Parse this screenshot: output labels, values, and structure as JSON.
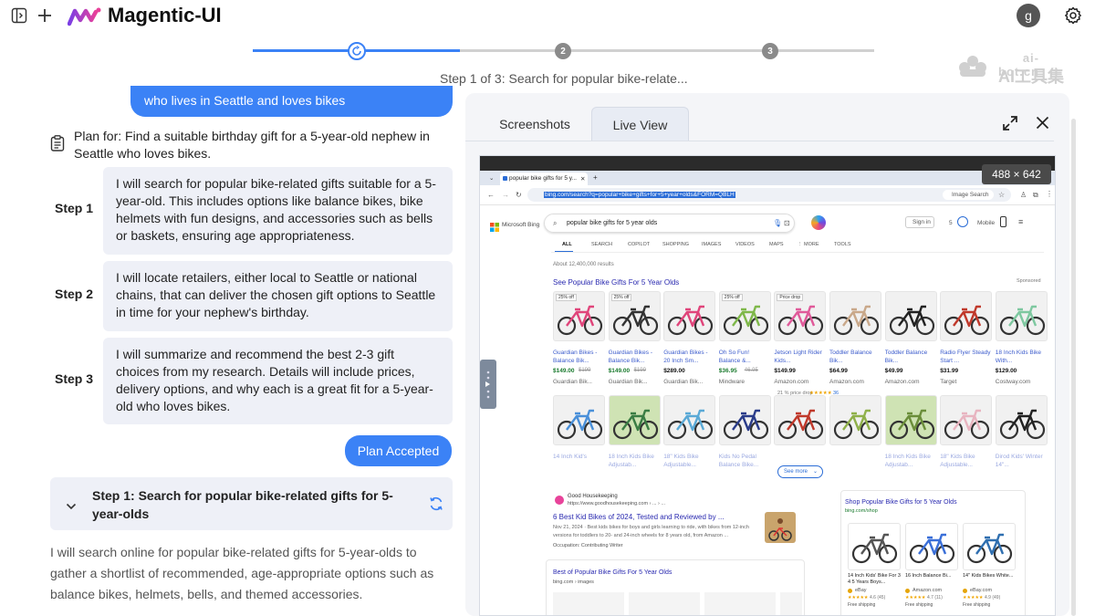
{
  "app": {
    "title": "Magentic-UI",
    "avatar_initial": "g"
  },
  "progress": {
    "steps": [
      "1",
      "2",
      "3"
    ],
    "current_step": 1,
    "caption": "Step 1 of 3: Search for popular bike-relate..."
  },
  "watermark": {
    "line1": "ai-bot.cn",
    "line2": "AI工具集"
  },
  "chat": {
    "user_message": "who lives in Seattle and loves bikes",
    "plan_title": "Plan for: Find a suitable birthday gift for a 5-year-old nephew in Seattle who loves bikes.",
    "steps": [
      {
        "label": "Step 1",
        "text": "I will search for popular bike-related gifts suitable for a 5-year-old. This includes options like balance bikes, bike helmets with fun designs, and accessories such as bells or baskets, ensuring age appropriateness."
      },
      {
        "label": "Step 2",
        "text": "I will locate retailers, either local to Seattle or national chains, that can deliver the chosen gift options to Seattle in time for your nephew's birthday."
      },
      {
        "label": "Step 3",
        "text": "I will summarize and recommend the best 2-3 gift choices from my research. Details will include prices, delivery options, and why each is a great fit for a 5-year-old who loves bikes."
      }
    ],
    "plan_accepted_label": "Plan Accepted",
    "current_step_title": "Step 1: Search for popular bike-related gifts for 5-year-olds",
    "current_step_summary": "I will search online for popular bike-related gifts for 5-year-olds to gather a shortlist of recommended, age-appropriate options such as balance bikes, helmets, bells, and themed accessories."
  },
  "panel": {
    "tabs": [
      "Screenshots",
      "Live View"
    ],
    "active_tab": "Live View",
    "size_badge": "488 × 642"
  },
  "browser": {
    "tab_title": "popular bike gifts for 5 y...",
    "url": "bing.com/search?q=popular+bike+gifts+for+5+year+olds&FORM=QBLH",
    "image_search": "Image Search",
    "logo": "Microsoft Bing",
    "query": "popular bike gifts for 5 year olds",
    "sign_in": "Sign in",
    "mobile": "Mobile",
    "nav": [
      "ALL",
      "SEARCH",
      "COPILOT",
      "SHOPPING",
      "IMAGES",
      "VIDEOS",
      "MAPS",
      "⋮ MORE",
      "TOOLS"
    ],
    "result_count": "About 12,400,000 results",
    "shopping_title": "See Popular Bike Gifts For 5 Year Olds",
    "sponsored": "Sponsored",
    "products_row1": [
      {
        "badge": "25% off",
        "name": "Guardian Bikes - Balance Bik...",
        "price": "$149.00",
        "old": "$199",
        "store": "Guardian Bik...",
        "color": "#e0457b"
      },
      {
        "badge": "25% off",
        "name": "Guardian Bikes - Balance Bik...",
        "price": "$149.00",
        "old": "$199",
        "store": "Guardian Bik...",
        "color": "#333"
      },
      {
        "badge": "",
        "name": "Guardian Bikes - 20 Inch Sm...",
        "price": "$289.00",
        "old": "",
        "store": "Guardian Bik...",
        "color": "#e0457b"
      },
      {
        "badge": "25% off",
        "name": "Oh So Fun! Balance &...",
        "price": "$36.95",
        "old": "46.95",
        "store": "Mindware",
        "color": "#7fb84a"
      },
      {
        "badge": "Price drop",
        "name": "Jetson Light Rider Kids...",
        "price": "$149.99",
        "old": "",
        "store": "Amazon.com",
        "color": "#e05a9a"
      },
      {
        "badge": "",
        "name": "Toddler Balance Bik...",
        "price": "$64.99",
        "old": "",
        "store": "Amazon.com",
        "color": "#c9a88a"
      },
      {
        "badge": "",
        "name": "Toddler Balance Bik...",
        "price": "$49.99",
        "old": "",
        "store": "Amazon.com",
        "color": "#222"
      },
      {
        "badge": "",
        "name": "Radio Flyer Steady Start ...",
        "price": "$31.99",
        "old": "",
        "store": "Target",
        "color": "#c0392b"
      },
      {
        "badge": "",
        "name": "18 Inch Kids Bike With...",
        "price": "$129.00",
        "old": "",
        "store": "Costway.com",
        "color": "#7ec8a0"
      }
    ],
    "price_note": "21 % price drop",
    "rating_count": "36",
    "products_row2": [
      {
        "name": "14 Inch Kid's",
        "color": "#4a90d9"
      },
      {
        "name": "18 Inch Kids Bike Adjustab...",
        "color": "#3a7d44"
      },
      {
        "name": "18\" Kids Bike Adjustable...",
        "color": "#5aa9d6"
      },
      {
        "name": "Kids No Pedal Balance Bike...",
        "color": "#2a3c8a"
      },
      {
        "name": "",
        "color": "#c0392b"
      },
      {
        "name": "",
        "color": "#8fb04a"
      },
      {
        "name": "18 Inch Kids Bike Adjustab...",
        "color": "#6b8e3a"
      },
      {
        "name": "18\" Kids Bike Adjustable...",
        "color": "#e8b4c0"
      },
      {
        "name": "Dirod Kids' Winter 14\"...",
        "color": "#222"
      }
    ],
    "see_more": "See more",
    "org_source": "Good Housekeeping",
    "org_url": "https://www.goodhousekeeping.com › ... › ...",
    "org_title": "6 Best Kid Bikes of 2024, Tested and Reviewed by ...",
    "org_snippet": "Nov 21, 2024 · Best kids bikes for boys and girls learning to ride, with bikes from 12-inch versions for toddlers to 20- and 24-inch wheels for 8 years old, from Amazon ...",
    "org_occupation": "Occupation: Contributing Writer",
    "images_title": "Best of Popular Bike Gifts For 5 Year Olds",
    "images_source": "bing.com › images",
    "side_title": "Shop Popular Bike Gifts for 5 Year Olds",
    "side_source": "bing.com/shop",
    "side_products": [
      {
        "name": "14 Inch Kids' Bike For 3 4 5 Years Boys...",
        "store": "eBay",
        "rating": "4.6 (45)",
        "ship": "Free shipping",
        "color": "#555"
      },
      {
        "name": "16 Inch Balance Bi...",
        "store": "Amazon.com",
        "rating": "4.7 (11)",
        "ship": "Free shipping",
        "color": "#3a6fd8"
      },
      {
        "name": "14\" Kids Bikes White...",
        "store": "eBay.com",
        "rating": "4.9 (49)",
        "ship": "Free shipping",
        "color": "#2f6fb0"
      }
    ]
  }
}
